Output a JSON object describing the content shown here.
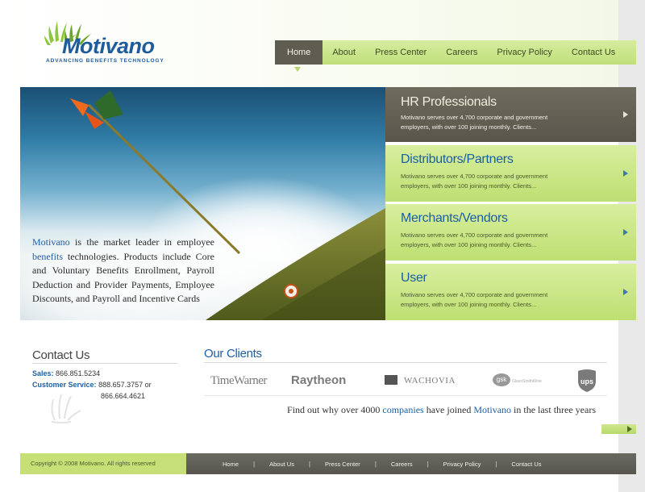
{
  "logo": {
    "name": "Motivano",
    "tagline": "ADVANCING BENEFITS TECHNOLOGY"
  },
  "nav": {
    "items": [
      {
        "label": "Home",
        "active": true
      },
      {
        "label": "About",
        "active": false
      },
      {
        "label": "Press Center",
        "active": false
      },
      {
        "label": "Careers",
        "active": false
      },
      {
        "label": "Privacy Policy",
        "active": false
      },
      {
        "label": "Contact Us",
        "active": false
      }
    ]
  },
  "hero": {
    "brand": "Motivano",
    "text1": " is the market leader in employee ",
    "highlight": "benefits",
    "text2": " technologies. Products include Core and Voluntary Benefits Enrollment, Payroll Deduction and Provider Payments, Employee Discounts, and Payroll and Incentive Cards"
  },
  "panels": [
    {
      "title": "HR Professionals",
      "desc": "Motivano serves over 4,700 corporate and government employers, with over 100 joining monthly. Clients..."
    },
    {
      "title": "Distributors/Partners",
      "desc": "Motivano serves over 4,700 corporate and government employers, with over 100 joining monthly. Clients..."
    },
    {
      "title": "Merchants/Vendors",
      "desc": "Motivano serves over 4,700 corporate and government employers, with over 100 joining monthly. Clients..."
    },
    {
      "title": "User",
      "desc": "Motivano serves over 4,700 corporate and government employers, with over 100 joining monthly. Clients..."
    }
  ],
  "contact": {
    "title": "Contact Us",
    "sales_label": "Sales:",
    "sales_phone": "866.851.5234",
    "service_label": "Customer Service:",
    "service_phone1": "888.657.3757 or",
    "service_phone2": "866.664.4621"
  },
  "clients": {
    "title": "Our Clients",
    "logos": [
      "TimeWarner",
      "Raytheon",
      "WACHOVIA",
      "gsk",
      "GlaxoSmithKline",
      "ups"
    ],
    "tagline_pre": "Find out why over 4000 ",
    "tagline_link1": "companies",
    "tagline_mid": " have joined ",
    "tagline_link2": "Motivano",
    "tagline_post": " in the last three years"
  },
  "footer": {
    "copyright": "Copyright © 2008 Motivano. All rights reserved",
    "links": [
      "Home",
      "About Us",
      "Press Center",
      "Careers",
      "Privacy Policy",
      "Contact Us"
    ],
    "separator": "|"
  },
  "colors": {
    "brand_blue": "#1b5fa3",
    "lime": "#c6e077",
    "dark_gray": "#5f5d52"
  }
}
